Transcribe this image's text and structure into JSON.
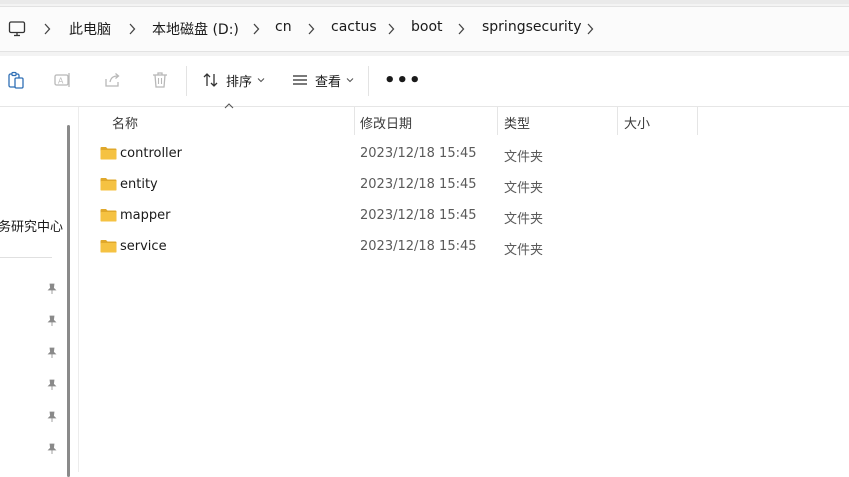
{
  "breadcrumb": {
    "items": [
      "此电脑",
      "本地磁盘 (D:)",
      "cn",
      "cactus",
      "boot",
      "springsecurity"
    ]
  },
  "toolbar": {
    "sort_label": "排序",
    "view_label": "查看",
    "more_label": "•••"
  },
  "nav": {
    "partial_label": "务研究中心",
    "pinned_count": 6
  },
  "columns": {
    "name": "名称",
    "date": "修改日期",
    "type": "类型",
    "size": "大小"
  },
  "files": [
    {
      "name": "controller",
      "date": "2023/12/18 15:45",
      "type": "文件夹"
    },
    {
      "name": "entity",
      "date": "2023/12/18 15:45",
      "type": "文件夹"
    },
    {
      "name": "mapper",
      "date": "2023/12/18 15:45",
      "type": "文件夹"
    },
    {
      "name": "service",
      "date": "2023/12/18 15:45",
      "type": "文件夹"
    }
  ],
  "colors": {
    "folder": "#f5c242",
    "folder_dark": "#e0a82b",
    "disabled_icon": "#b8b8b8"
  }
}
